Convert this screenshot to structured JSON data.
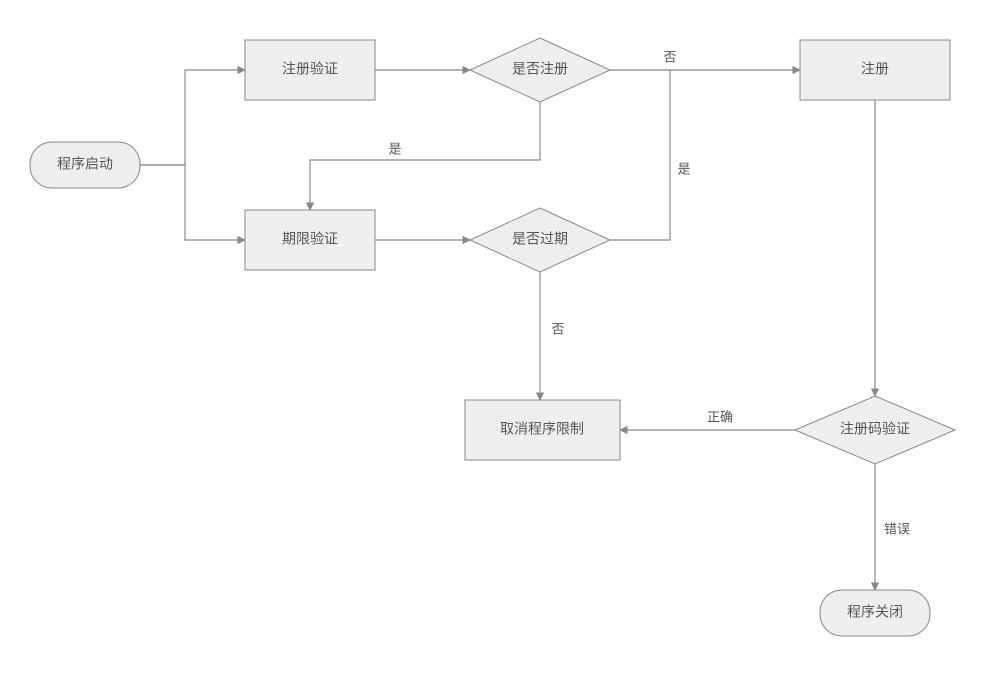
{
  "nodes": {
    "start": "程序启动",
    "regCheck": "注册验证",
    "isRegistered": "是否注册",
    "register": "注册",
    "periodCheck": "期限验证",
    "isExpired": "是否过期",
    "cancelLimit": "取消程序限制",
    "codeVerify": "注册码验证",
    "end": "程序关闭"
  },
  "edges": {
    "isReg_no": "否",
    "isReg_yes": "是",
    "isExp_yes": "是",
    "isExp_no": "否",
    "code_ok": "正确",
    "code_err": "错误"
  },
  "chart_data": {
    "type": "flowchart",
    "title": "",
    "nodes": [
      {
        "id": "start",
        "type": "terminal",
        "label": "程序启动"
      },
      {
        "id": "regCheck",
        "type": "process",
        "label": "注册验证"
      },
      {
        "id": "isRegistered",
        "type": "decision",
        "label": "是否注册"
      },
      {
        "id": "register",
        "type": "process",
        "label": "注册"
      },
      {
        "id": "periodCheck",
        "type": "process",
        "label": "期限验证"
      },
      {
        "id": "isExpired",
        "type": "decision",
        "label": "是否过期"
      },
      {
        "id": "cancelLimit",
        "type": "process",
        "label": "取消程序限制"
      },
      {
        "id": "codeVerify",
        "type": "decision",
        "label": "注册码验证"
      },
      {
        "id": "end",
        "type": "terminal",
        "label": "程序关闭"
      }
    ],
    "edges": [
      {
        "from": "start",
        "to": "regCheck",
        "label": ""
      },
      {
        "from": "start",
        "to": "periodCheck",
        "label": ""
      },
      {
        "from": "regCheck",
        "to": "isRegistered",
        "label": ""
      },
      {
        "from": "isRegistered",
        "to": "register",
        "label": "否"
      },
      {
        "from": "isRegistered",
        "to": "periodCheck",
        "label": "是"
      },
      {
        "from": "periodCheck",
        "to": "isExpired",
        "label": ""
      },
      {
        "from": "isExpired",
        "to": "register",
        "label": "是"
      },
      {
        "from": "isExpired",
        "to": "cancelLimit",
        "label": "否"
      },
      {
        "from": "register",
        "to": "codeVerify",
        "label": ""
      },
      {
        "from": "codeVerify",
        "to": "cancelLimit",
        "label": "正确"
      },
      {
        "from": "codeVerify",
        "to": "end",
        "label": "错误"
      }
    ]
  }
}
